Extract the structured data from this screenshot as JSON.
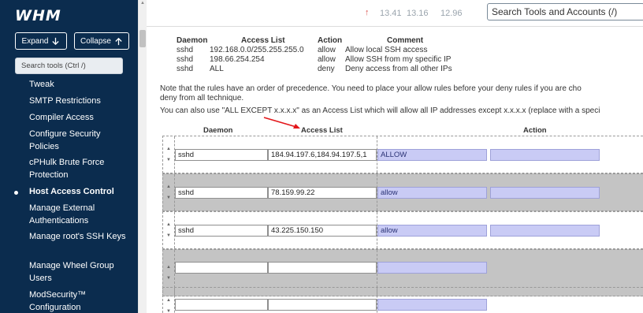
{
  "brand": {
    "logo": "WHM"
  },
  "sidebar": {
    "expand_label": "Expand",
    "collapse_label": "Collapse",
    "search_placeholder": "Search tools (Ctrl /)",
    "items": [
      {
        "label": "Tweak"
      },
      {
        "label": "SMTP Restrictions"
      },
      {
        "label": "Compiler Access"
      },
      {
        "label": "Configure Security Policies"
      },
      {
        "label": "cPHulk Brute Force Protection"
      },
      {
        "label": "Host Access Control",
        "active": true
      },
      {
        "label": "Manage External Authentications"
      },
      {
        "label": "Manage root's SSH Keys"
      },
      {
        "label": "Manage Wheel Group Users"
      },
      {
        "label": "ModSecurity™ Configuration"
      }
    ]
  },
  "header": {
    "load_averages": [
      "13.41",
      "13.16",
      "12.96"
    ],
    "search_placeholder": "Search Tools and Accounts (/)"
  },
  "example": {
    "headers": {
      "daemon": "Daemon",
      "access": "Access List",
      "action": "Action",
      "comment": "Comment"
    },
    "rows": [
      {
        "daemon": "sshd",
        "access": "192.168.0.0/255.255.255.0",
        "action": "allow",
        "comment": "Allow local SSH access"
      },
      {
        "daemon": "sshd",
        "access": "198.66.254.254",
        "action": "allow",
        "comment": "Allow SSH from my specific IP"
      },
      {
        "daemon": "sshd",
        "access": "ALL",
        "action": "deny",
        "comment": "Deny access from all other IPs"
      }
    ]
  },
  "notes": {
    "line1": "Note that the rules have an order of precedence. You need to place your allow rules before your deny rules if you are cho",
    "line2": "deny from all technique.",
    "line3": "You can also use \"ALL EXCEPT x.x.x.x\" as an Access List which will allow all IP addresses except x.x.x.x (replace with a speci"
  },
  "table": {
    "headers": {
      "daemon": "Daemon",
      "access": "Access List",
      "action": "Action"
    },
    "rows": [
      {
        "daemon": "sshd",
        "access": "184.94.197.6,184.94.197.5,1",
        "action": "ALLOW",
        "comment": ""
      },
      {
        "daemon": "sshd",
        "access": "78.159.99.22",
        "action": "allow",
        "comment": ""
      },
      {
        "daemon": "sshd",
        "access": "43.225.150.150",
        "action": "allow",
        "comment": ""
      },
      {
        "daemon": "",
        "access": "",
        "action": "",
        "comment": ""
      },
      {
        "daemon": "",
        "access": "",
        "action": "",
        "comment": ""
      }
    ]
  },
  "colors": {
    "sidebar_bg": "#0b2c4e",
    "action_field": "#c9cbf5",
    "alt_row": "#c4c4c4",
    "annotation_arrow": "#e3161a"
  }
}
